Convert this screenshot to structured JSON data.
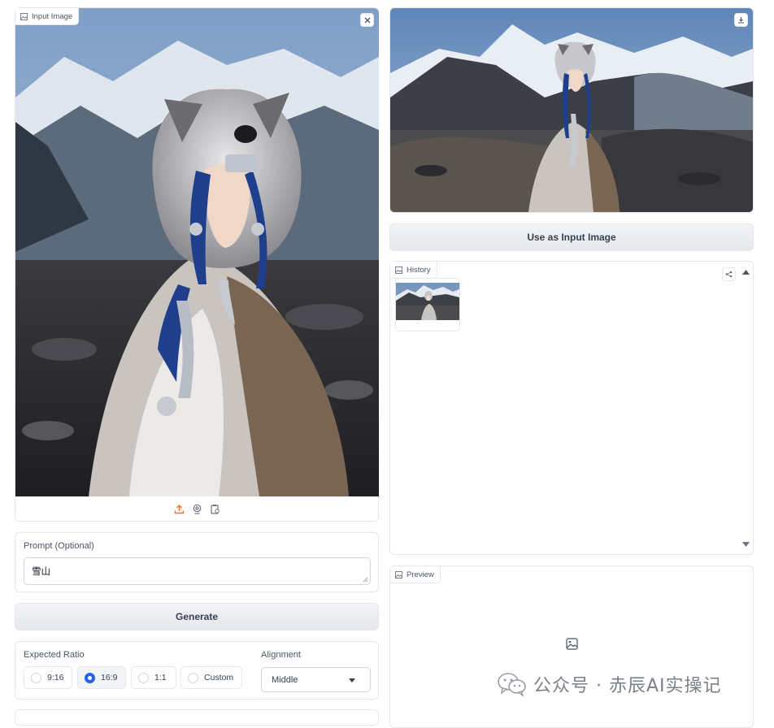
{
  "input_image": {
    "label": "Input Image"
  },
  "output_image": {},
  "use_as_input_button": "Use as Input Image",
  "history": {
    "label": "History"
  },
  "preview": {
    "label": "Preview"
  },
  "prompt": {
    "label": "Prompt (Optional)",
    "value": "雪山"
  },
  "generate_button": "Generate",
  "expected_ratio": {
    "label": "Expected Ratio",
    "options": [
      "9:16",
      "16:9",
      "1:1",
      "Custom"
    ],
    "selected": "16:9"
  },
  "alignment": {
    "label": "Alignment",
    "value": "Middle"
  },
  "watermark": "公众号 · 赤辰AI实操记",
  "colors": {
    "accent": "#2563eb",
    "upload_icon": "#f97316",
    "border": "#e5e7eb"
  }
}
